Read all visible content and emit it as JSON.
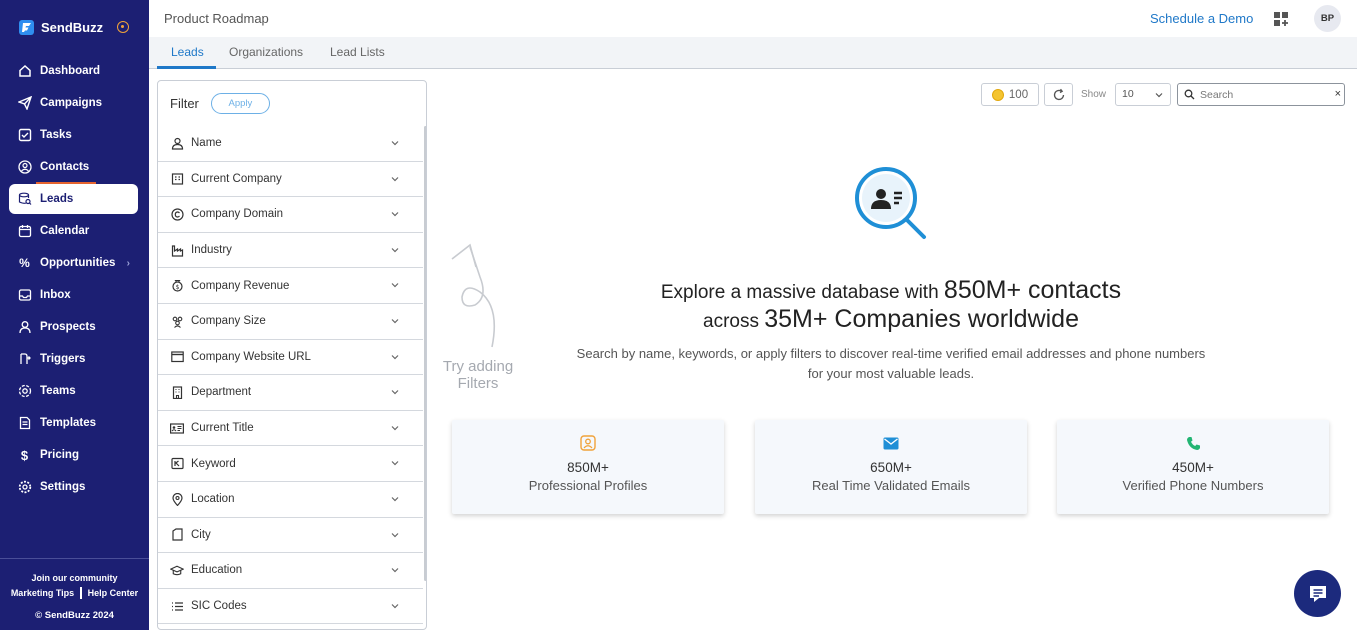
{
  "brand": {
    "name": "SendBuzz"
  },
  "sidebar": {
    "items": [
      {
        "label": "Dashboard",
        "icon": "home-icon"
      },
      {
        "label": "Campaigns",
        "icon": "send-icon"
      },
      {
        "label": "Tasks",
        "icon": "task-icon"
      },
      {
        "label": "Contacts",
        "icon": "contact-icon"
      },
      {
        "label": "Leads",
        "icon": "leads-icon",
        "active": true
      },
      {
        "label": "Calendar",
        "icon": "calendar-icon"
      },
      {
        "label": "Opportunities",
        "icon": "percent-icon"
      },
      {
        "label": "Inbox",
        "icon": "inbox-icon"
      },
      {
        "label": "Prospects",
        "icon": "prospect-icon"
      },
      {
        "label": "Triggers",
        "icon": "trigger-icon"
      },
      {
        "label": "Teams",
        "icon": "teams-icon"
      },
      {
        "label": "Templates",
        "icon": "template-icon"
      },
      {
        "label": "Pricing",
        "icon": "dollar-icon"
      },
      {
        "label": "Settings",
        "icon": "gear-icon"
      }
    ],
    "footer": {
      "community": "Join our community",
      "marketing_tips": "Marketing Tips",
      "help_center": "Help Center",
      "copyright": "© SendBuzz 2024"
    }
  },
  "header": {
    "title": "Product Roadmap",
    "schedule_demo": "Schedule a Demo",
    "avatar_initials": "BP"
  },
  "tabs": [
    {
      "label": "Leads",
      "active": true
    },
    {
      "label": "Organizations"
    },
    {
      "label": "Lead Lists"
    }
  ],
  "filter": {
    "title": "Filter",
    "apply_label": "Apply",
    "items": [
      {
        "label": "Name",
        "icon": "person-icon"
      },
      {
        "label": "Current Company",
        "icon": "building-icon"
      },
      {
        "label": "Company Domain",
        "icon": "copyright-icon"
      },
      {
        "label": "Industry",
        "icon": "factory-icon"
      },
      {
        "label": "Company Revenue",
        "icon": "money-bag-icon"
      },
      {
        "label": "Company Size",
        "icon": "people-icon"
      },
      {
        "label": "Company Website URL",
        "icon": "browser-icon"
      },
      {
        "label": "Department",
        "icon": "office-icon"
      },
      {
        "label": "Current Title",
        "icon": "id-card-icon"
      },
      {
        "label": "Keyword",
        "icon": "key-icon"
      },
      {
        "label": "Location",
        "icon": "pin-icon"
      },
      {
        "label": "City",
        "icon": "tag-icon"
      },
      {
        "label": "Education",
        "icon": "graduation-icon"
      },
      {
        "label": "SIC Codes",
        "icon": "list-icon"
      }
    ]
  },
  "toolbar": {
    "credits": "100",
    "show_label": "Show",
    "show_value": "10",
    "search_placeholder": "Search"
  },
  "hint": {
    "line1": "Try adding",
    "line2": "Filters"
  },
  "hero": {
    "line1_prefix": "Explore a massive database with ",
    "line1_big": "850M+ contacts",
    "line2_prefix": "across ",
    "line2_big": "35M+ Companies worldwide",
    "subtitle_line1": "Search by name, keywords, or apply filters to discover real-time verified email addresses and phone numbers",
    "subtitle_line2": "for your most valuable leads."
  },
  "stats": [
    {
      "value": "850M+",
      "label": "Professional Profiles",
      "icon": "profile-icon",
      "color": "#f0a23a"
    },
    {
      "value": "650M+",
      "label": "Real Time Validated Emails",
      "icon": "mail-icon",
      "color": "#1f8fd6"
    },
    {
      "value": "450M+",
      "label": "Verified Phone Numbers",
      "icon": "phone-icon",
      "color": "#22b573"
    }
  ],
  "colors": {
    "sidebar_bg": "#1c1f73",
    "accent": "#1f78c8",
    "active_marker": "#e5642f"
  }
}
